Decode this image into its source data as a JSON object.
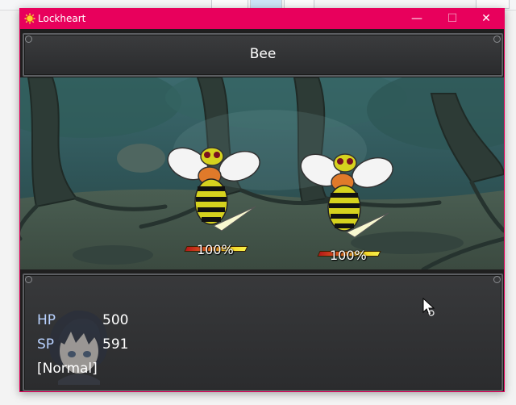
{
  "window": {
    "title": "Lockheart",
    "controls": {
      "minimize": "—",
      "maximize": "☐",
      "close": "✕"
    },
    "accent_color": "#e8005c"
  },
  "battle": {
    "enemy_name": "Bee",
    "enemies": [
      {
        "name": "Bee",
        "hp_percent_label": "100%",
        "hp_fraction": 1.0
      },
      {
        "name": "Bee",
        "hp_percent_label": "100%",
        "hp_fraction": 1.0
      }
    ]
  },
  "party": {
    "hp_label": "HP",
    "hp_value": "500",
    "sp_label": "SP",
    "sp_value": "591",
    "state": "[Normal]"
  },
  "icons": [
    "app-sun-icon",
    "mouse-cursor-icon"
  ]
}
